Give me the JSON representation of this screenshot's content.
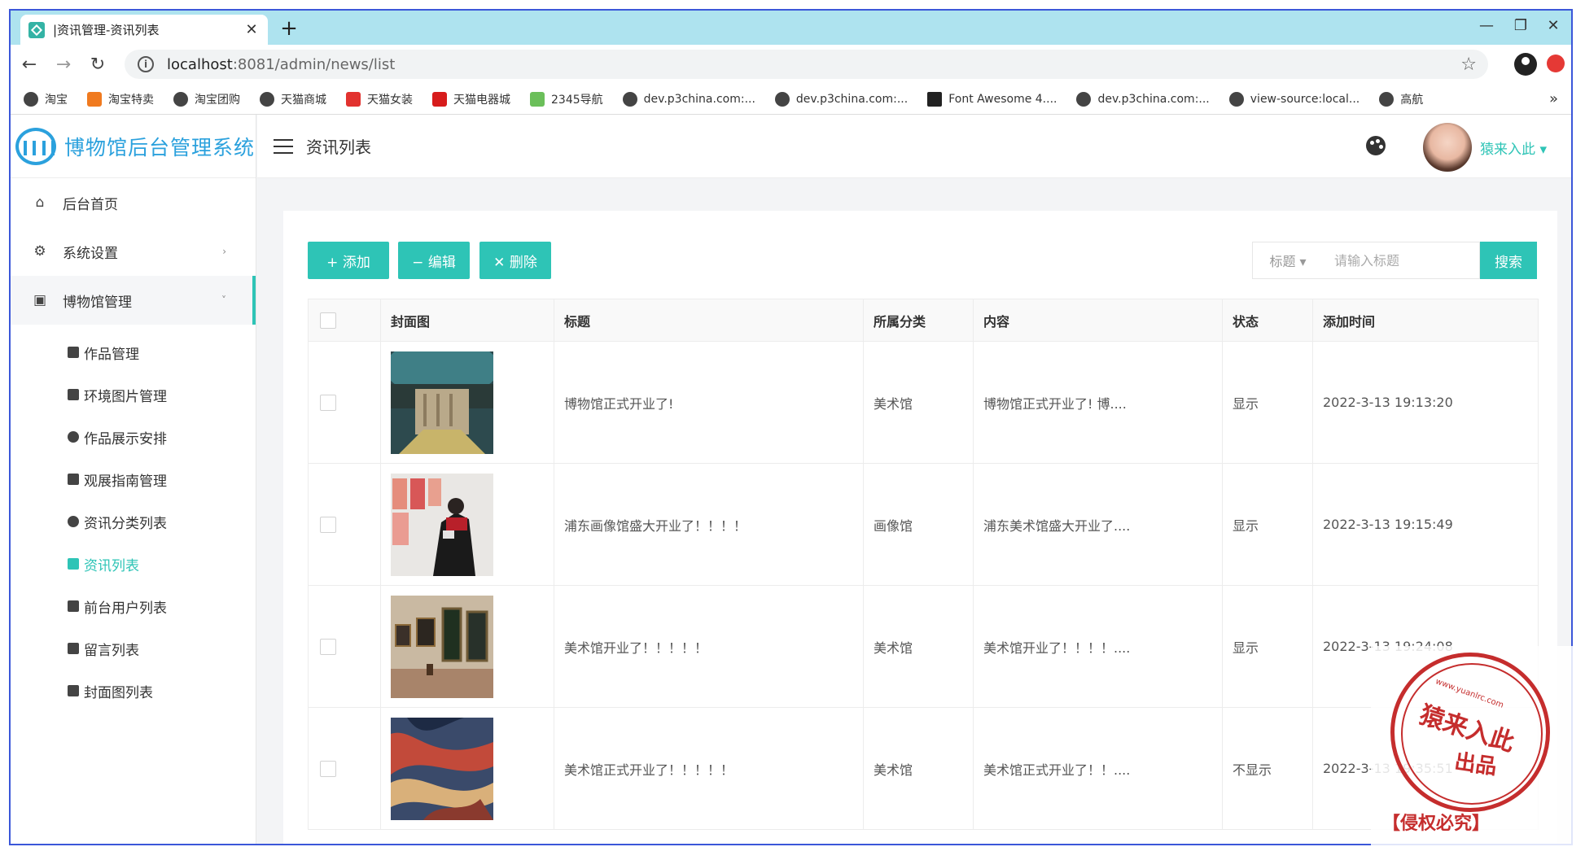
{
  "browser": {
    "tab_title": "|资讯管理-资讯列表",
    "close_glyph": "✕",
    "newtab_glyph": "+",
    "url_host": "localhost",
    "url_path": ":8081/admin/news/list",
    "bookmarks": [
      "淘宝",
      "淘宝特卖",
      "淘宝团购",
      "天猫商城",
      "天猫女装",
      "天猫电器城",
      "2345导航",
      "dev.p3china.com:...",
      "dev.p3china.com:...",
      "Font Awesome 4....",
      "dev.p3china.com:...",
      "view-source:local...",
      "高航"
    ],
    "more_glyph": "»"
  },
  "sidebar": {
    "logo_text": "博物馆后台管理系统",
    "menu": [
      {
        "label": "后台首页",
        "icon": "home-icon"
      },
      {
        "label": "系统设置",
        "icon": "gear-icon",
        "arrow": "›"
      },
      {
        "label": "博物馆管理",
        "icon": "image-icon",
        "arrow": "˅"
      }
    ],
    "submenu": [
      {
        "label": "作品管理"
      },
      {
        "label": "环境图片管理"
      },
      {
        "label": "作品展示安排"
      },
      {
        "label": "观展指南管理"
      },
      {
        "label": "资讯分类列表"
      },
      {
        "label": "资讯列表",
        "active": true
      },
      {
        "label": "前台用户列表"
      },
      {
        "label": "留言列表"
      },
      {
        "label": "封面图列表"
      }
    ]
  },
  "header": {
    "title": "资讯列表",
    "username": "猿来入此 ▾"
  },
  "toolbar": {
    "add_label": "+ 添加",
    "edit_label": "− 编辑",
    "delete_label": "✕ 删除",
    "search_field": "标题 ▾",
    "search_placeholder": "请输入标题",
    "search_label": "搜索"
  },
  "table": {
    "columns": [
      "",
      "封面图",
      "标题",
      "所属分类",
      "内容",
      "状态",
      "添加时间"
    ],
    "rows": [
      {
        "title": "博物馆正式开业了!",
        "category": "美术馆",
        "content": "博物馆正式开业了! 博....",
        "status": "显示",
        "time": "2022-3-13 19:13:20"
      },
      {
        "title": "浦东画像馆盛大开业了！！！！",
        "category": "画像馆",
        "content": "浦东美术馆盛大开业了....",
        "status": "显示",
        "time": "2022-3-13 19:15:49"
      },
      {
        "title": "美术馆开业了！！！！！",
        "category": "美术馆",
        "content": "美术馆开业了！！！！....",
        "status": "显示",
        "time": "2022-3-13 19:24:08"
      },
      {
        "title": "美术馆正式开业了！！！！！",
        "category": "美术馆",
        "content": "美术馆正式开业了！！....",
        "status": "不显示",
        "time": "2022-3-13 19:35:51"
      }
    ]
  },
  "watermark": {
    "url": "www.yuanlrc.com",
    "main": "猿来入此",
    "sub": "出品",
    "foot": "【侵权必究】"
  },
  "colors": {
    "accent": "#2ec4b6",
    "brand": "#2ba1dd",
    "warning": "#ff9c3a",
    "stamp": "#c52d2d"
  }
}
